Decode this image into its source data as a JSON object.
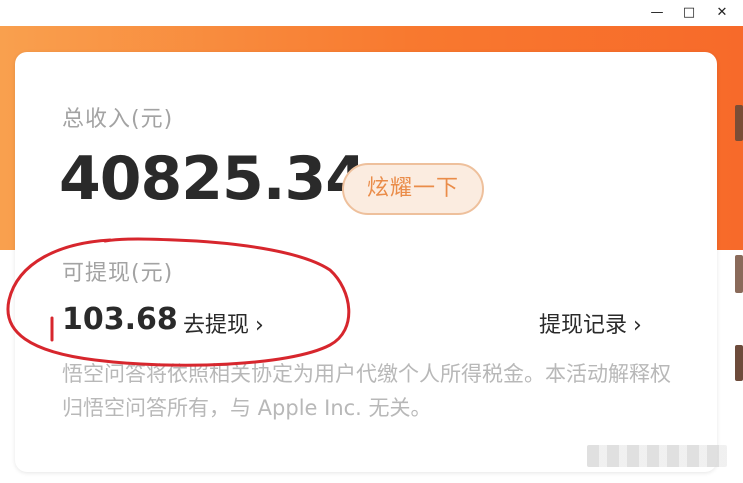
{
  "window": {
    "minimize_icon": "minimize-icon",
    "maximize_icon": "maximize-icon",
    "close_icon": "close-icon"
  },
  "colors": {
    "accent_orange": "#f8792f",
    "badge_bg": "#fbece0",
    "badge_text": "#ea8c49",
    "annotation_red": "#d7262d"
  },
  "income": {
    "total_label": "总收入(元)",
    "total_amount": "40825.34",
    "show_off_label": "炫耀一下"
  },
  "withdraw": {
    "label": "可提现(元)",
    "amount": "103.68",
    "action_label": "去提现",
    "records_label": "提现记录",
    "chevron": "›"
  },
  "notice": {
    "text": "悟空问答将依照相关协定为用户代缴个人所得税金。本活动解释权归悟空问答所有，与 Apple Inc. 无关。"
  }
}
